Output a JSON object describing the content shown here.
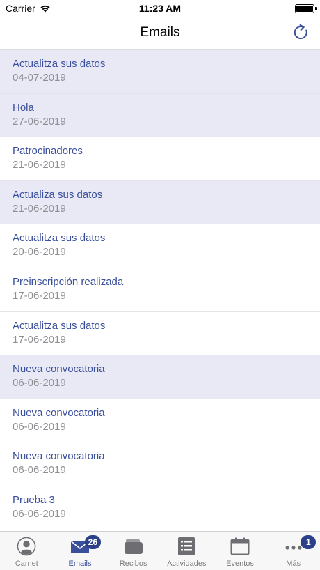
{
  "status_bar": {
    "carrier": "Carrier",
    "time": "11:23 AM"
  },
  "nav": {
    "title": "Emails",
    "refresh_icon": "refresh-icon"
  },
  "emails": [
    {
      "subject": "Actualitza sus datos",
      "date": "04-07-2019",
      "unread": true
    },
    {
      "subject": "Hola",
      "date": "27-06-2019",
      "unread": true
    },
    {
      "subject": "Patrocinadores",
      "date": "21-06-2019",
      "unread": false
    },
    {
      "subject": "Actualiza sus datos",
      "date": "21-06-2019",
      "unread": true
    },
    {
      "subject": "Actualitza sus datos",
      "date": "20-06-2019",
      "unread": false
    },
    {
      "subject": "Preinscripción realizada",
      "date": "17-06-2019",
      "unread": false
    },
    {
      "subject": "Actualitza sus datos",
      "date": "17-06-2019",
      "unread": false
    },
    {
      "subject": "Nueva convocatoria",
      "date": "06-06-2019",
      "unread": true
    },
    {
      "subject": "Nueva convocatoria",
      "date": "06-06-2019",
      "unread": false
    },
    {
      "subject": "Nueva convocatoria",
      "date": "06-06-2019",
      "unread": false
    },
    {
      "subject": "Prueba 3",
      "date": "06-06-2019",
      "unread": false
    }
  ],
  "tabs": [
    {
      "label": "Carnet",
      "icon": "person-icon",
      "badge": null,
      "active": false
    },
    {
      "label": "Emails",
      "icon": "envelope-icon",
      "badge": "26",
      "active": true
    },
    {
      "label": "Recibos",
      "icon": "wallet-icon",
      "badge": null,
      "active": false
    },
    {
      "label": "Actividades",
      "icon": "list-icon",
      "badge": null,
      "active": false
    },
    {
      "label": "Eventos",
      "icon": "calendar-icon",
      "badge": null,
      "active": false
    },
    {
      "label": "Más",
      "icon": "more-icon",
      "badge": "1",
      "active": false
    }
  ],
  "colors": {
    "accent": "#3a4f9c",
    "unread_bg": "#e8e9f5",
    "badge": "#2c3f8a",
    "inactive_icon": "#6e6e72"
  }
}
